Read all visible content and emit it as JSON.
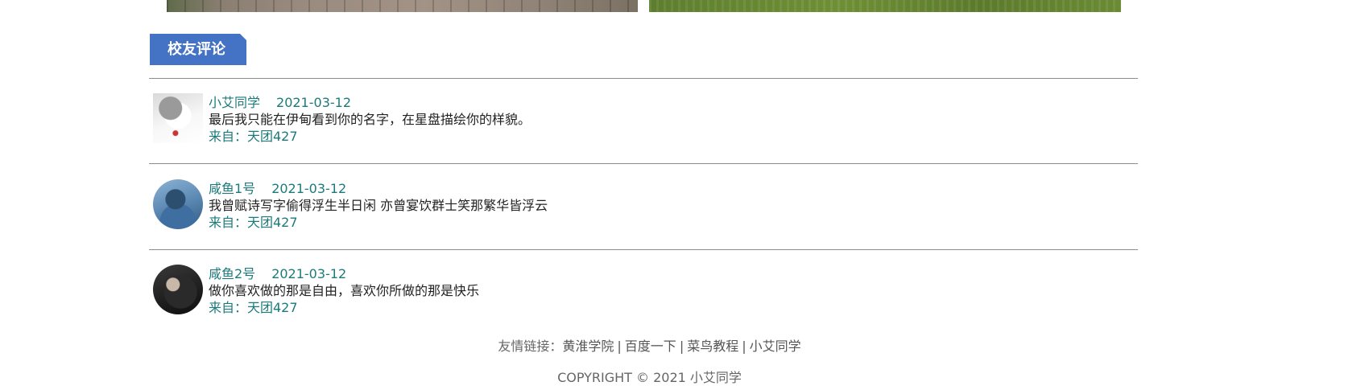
{
  "section": {
    "title": "校友评论"
  },
  "comments": [
    {
      "author": "小艾同学",
      "date": "2021-03-12",
      "text": "最后我只能在伊甸看到你的名字，在星盘描绘你的样貌。",
      "source": "来自：天团427"
    },
    {
      "author": "咸鱼1号",
      "date": "2021-03-12",
      "text": "我曾赋诗写字偷得浮生半日闲 亦曾宴饮群士笑那繁华皆浮云",
      "source": "来自：天团427"
    },
    {
      "author": "咸鱼2号",
      "date": "2021-03-12",
      "text": "做你喜欢做的那是自由，喜欢你所做的那是快乐",
      "source": "来自：天团427"
    }
  ],
  "footer": {
    "links_label": "友情链接：",
    "links": [
      "黄淮学院",
      "百度一下",
      "菜鸟教程",
      "小艾同学"
    ],
    "separator": "|",
    "copyright": "COPYRIGHT © 2021 小艾同学"
  }
}
